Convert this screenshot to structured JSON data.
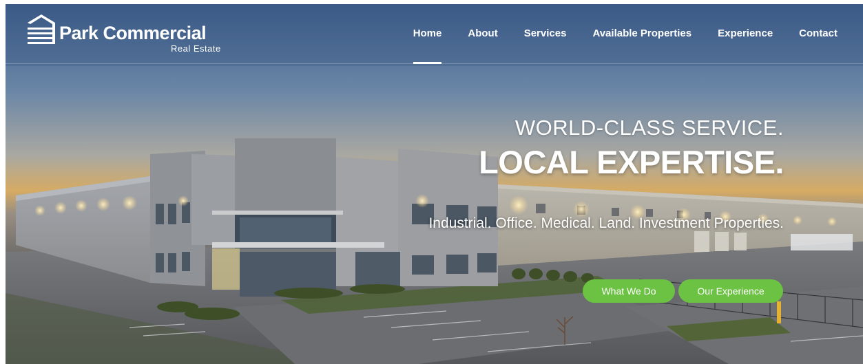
{
  "brand": {
    "name": "Park Commercial",
    "subtitle": "Real Estate"
  },
  "nav": {
    "items": [
      {
        "label": "Home",
        "active": true
      },
      {
        "label": "About",
        "active": false
      },
      {
        "label": "Services",
        "active": false
      },
      {
        "label": "Available Properties",
        "active": false
      },
      {
        "label": "Experience",
        "active": false
      },
      {
        "label": "Contact",
        "active": false
      }
    ]
  },
  "hero": {
    "line1": "WORLD-CLASS SERVICE.",
    "line2": "LOCAL EXPERTISE.",
    "line3": "Industrial. Office. Medical. Land. Investment Properties.",
    "buttons": [
      {
        "label": "What We Do"
      },
      {
        "label": "Our Experience"
      }
    ]
  },
  "colors": {
    "accent": "#6cc243",
    "text": "#ffffff"
  }
}
